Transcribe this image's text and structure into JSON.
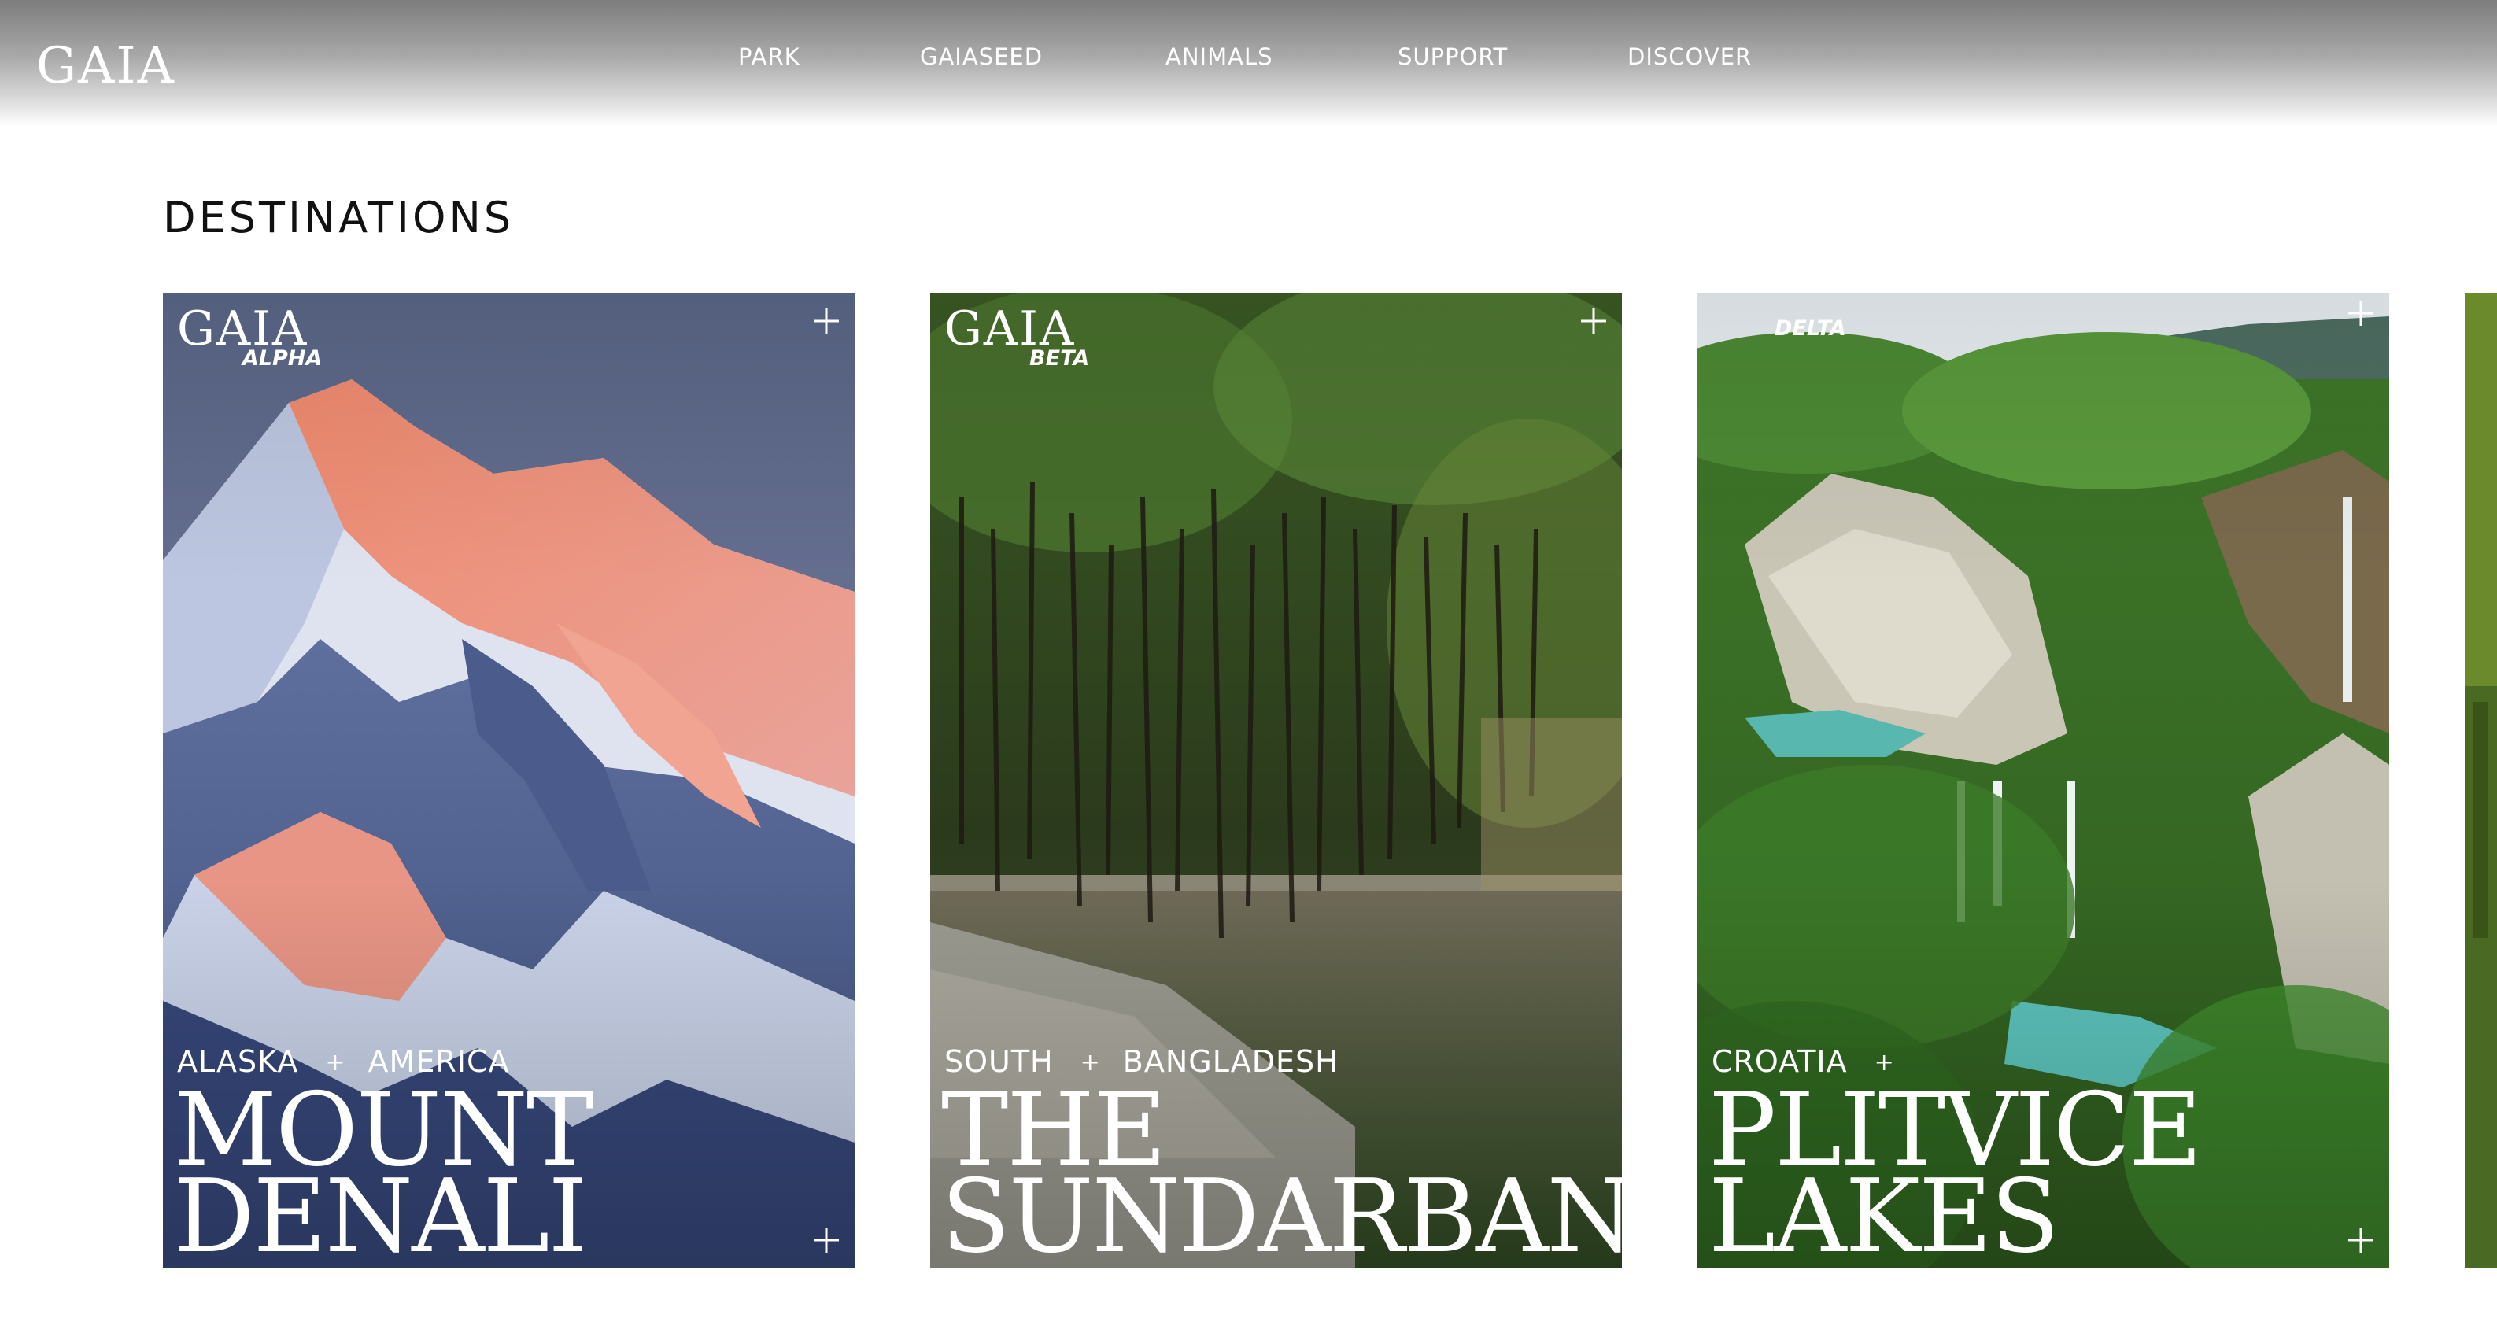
{
  "brand": {
    "logo_text": "GAIA"
  },
  "nav": {
    "items": [
      {
        "label": "PARK"
      },
      {
        "label": "GAIASEED"
      },
      {
        "label": "ANIMALS"
      },
      {
        "label": "SUPPORT"
      },
      {
        "label": "DISCOVER"
      }
    ]
  },
  "section": {
    "title": "DESTINATIONS"
  },
  "cards": [
    {
      "brand": "GAIA",
      "tier": "ALPHA",
      "region": "ALASKA",
      "country": "AMERICA",
      "separator": "+",
      "title_line1": "MOUNT",
      "title_line2": "DENALI"
    },
    {
      "brand": "GAIA",
      "tier": "BETA",
      "region": "SOUTH",
      "country": "BANGLADESH",
      "separator": "+",
      "title_line1": "THE",
      "title_line2": "SUNDARBANS"
    },
    {
      "brand": "",
      "tier": "DELTA",
      "region": "CROATIA",
      "country": "",
      "separator": "+",
      "title_line1": "PLITVICE",
      "title_line2": "LAKES"
    },
    {
      "brand": "",
      "tier": "",
      "region": "",
      "country": "",
      "separator": "",
      "title_line1": "",
      "title_line2": ""
    }
  ],
  "icons": {
    "card_expand": "plus-icon"
  },
  "colors": {
    "header_gradient_top": "#7d7d7d",
    "text_light": "#ffffff",
    "text_dark": "#111111",
    "background": "#ffffff"
  }
}
